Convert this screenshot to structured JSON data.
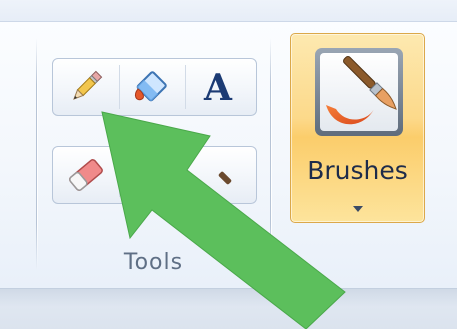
{
  "ribbon": {
    "tools_group": {
      "label": "Tools",
      "tools": [
        {
          "name": "pencil",
          "icon": "pencil-icon"
        },
        {
          "name": "fill",
          "icon": "fill-bucket-icon"
        },
        {
          "name": "text",
          "icon": "text-tool-icon",
          "glyph": "A"
        },
        {
          "name": "eraser",
          "icon": "eraser-icon"
        },
        {
          "name": "color-picker",
          "icon": "color-picker-icon"
        },
        {
          "name": "magnifier",
          "icon": "magnifier-icon"
        }
      ]
    },
    "brushes": {
      "label": "Brushes",
      "icon": "brush-icon",
      "dropdown_icon": "dropdown-arrow-icon"
    }
  },
  "annotation": {
    "icon": "green-arrow-icon",
    "color": "#5cbf5c"
  },
  "colors": {
    "brushes_active": "#fcd98a",
    "label_text": "#5f6f85",
    "brush_label_text": "#1d2b4a"
  }
}
